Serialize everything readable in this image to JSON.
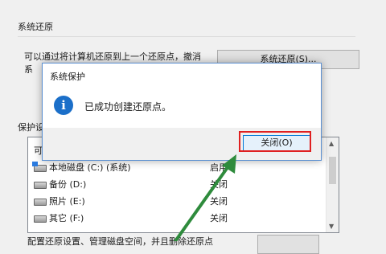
{
  "background": {
    "section_title": "系统还原",
    "description_line1": "可以通过将计算机还原到上一个还原点，撤消",
    "description_line2": "系",
    "restore_button": "系统还原(S)...",
    "protection_label": "保护设",
    "list_header": "可",
    "drives": [
      {
        "name": "本地磁盘 (C:) (系统)",
        "status": "启用",
        "icon": "system-drive-icon"
      },
      {
        "name": "备份 (D:)",
        "status": "关闭",
        "icon": "drive-icon"
      },
      {
        "name": "照片 (E:)",
        "status": "关闭",
        "icon": "drive-icon"
      },
      {
        "name": "其它 (F:)",
        "status": "关闭",
        "icon": "drive-icon"
      }
    ],
    "bottom_text": "配置还原设置、管理磁盘空间，并且删除还原点"
  },
  "dialog": {
    "title": "系统保护",
    "message": "已成功创建还原点。",
    "icon": "info-icon",
    "close_button": "关闭(O)"
  },
  "colors": {
    "highlight_box": "#e02020",
    "arrow": "#2e8b3c",
    "info_icon": "#1b6fc9"
  }
}
